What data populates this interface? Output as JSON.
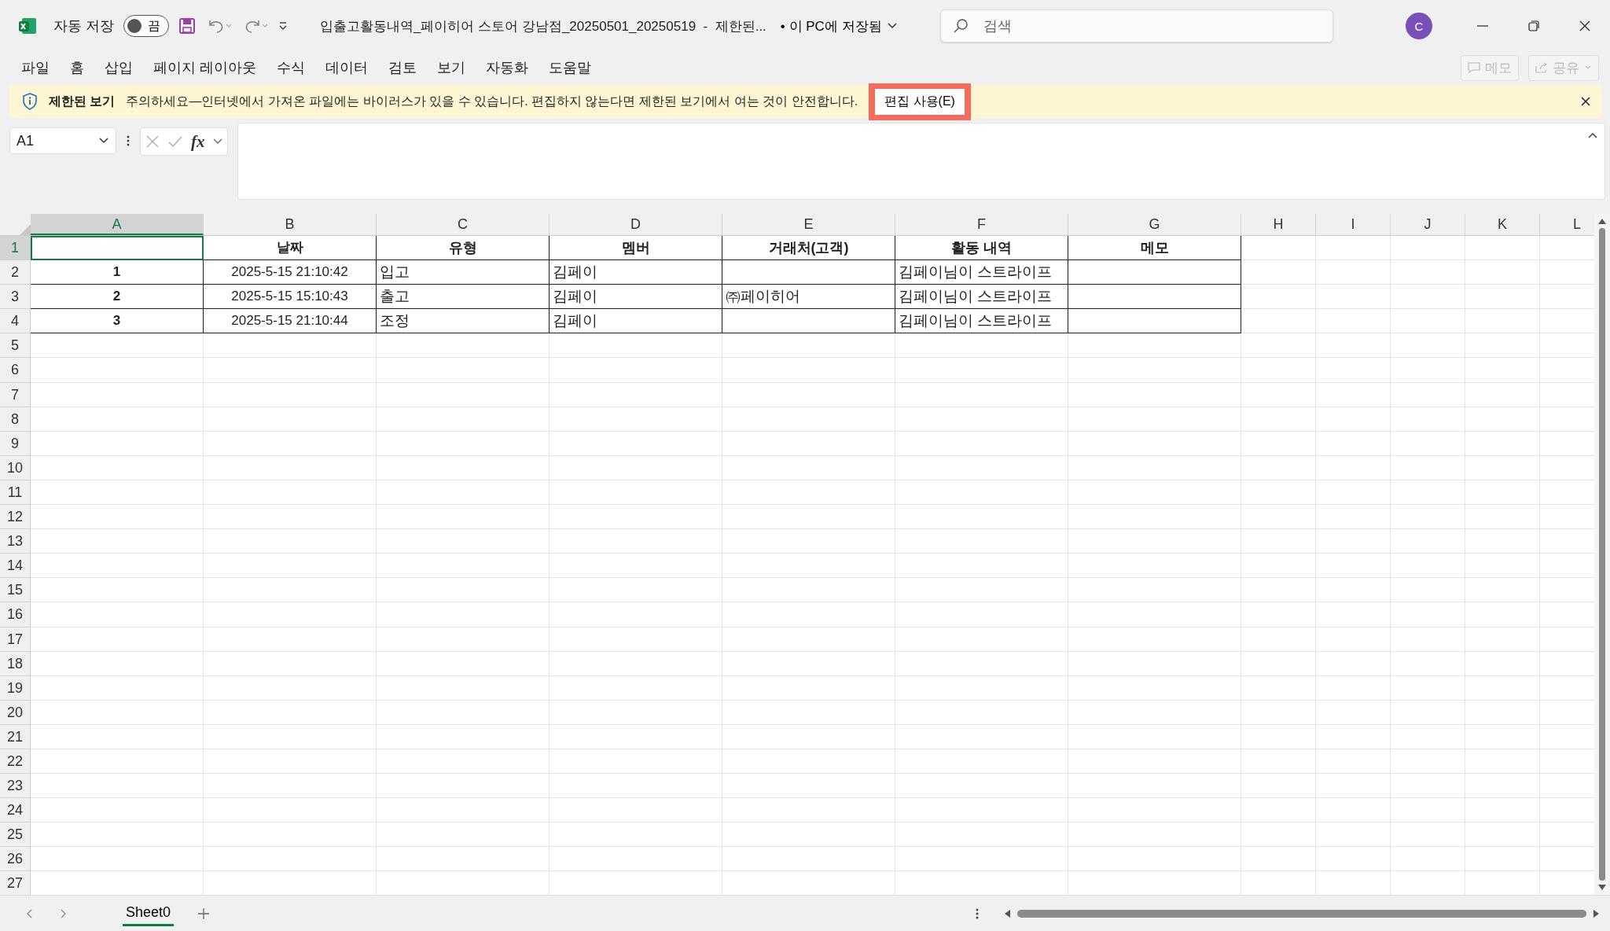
{
  "title_bar": {
    "autosave_label": "자동 저장",
    "autosave": {
      "on": false,
      "label": "끔"
    },
    "document_title": "입출고활동내역_페이히어 스토어 강남점_20250501_20250519  -  제한된...",
    "save_status": "• 이 PC에 저장됨",
    "search": {
      "placeholder": "검색"
    },
    "avatar": "C"
  },
  "menu": [
    {
      "label": "파일"
    },
    {
      "label": "홈"
    },
    {
      "label": "삽입"
    },
    {
      "label": "페이지 레이아웃"
    },
    {
      "label": "수식"
    },
    {
      "label": "데이터"
    },
    {
      "label": "검토"
    },
    {
      "label": "보기"
    },
    {
      "label": "자동화"
    },
    {
      "label": "도움말"
    }
  ],
  "ribbon_buttons": [
    {
      "label": "메모",
      "disabled": true
    },
    {
      "label": "공유",
      "disabled": true
    }
  ],
  "message_bar": {
    "title": "제한된 보기",
    "text": "주의하세요—인터넷에서 가져온 파일에는 바이러스가 있을 수 있습니다. 편집하지 않는다면 제한된 보기에서 여는 것이 안전합니다.",
    "button": "편집 사용(E)"
  },
  "formula_bar": {
    "name_box": "A1",
    "fx": "fx"
  },
  "columns": [
    {
      "label": "A",
      "selected": true
    },
    {
      "label": "B",
      "selected": false
    },
    {
      "label": "C",
      "selected": false
    },
    {
      "label": "D",
      "selected": false
    },
    {
      "label": "E",
      "selected": false
    },
    {
      "label": "F",
      "selected": false
    },
    {
      "label": "G",
      "selected": false
    },
    {
      "label": "H",
      "selected": false
    },
    {
      "label": "I",
      "selected": false
    },
    {
      "label": "J",
      "selected": false
    },
    {
      "label": "K",
      "selected": false
    },
    {
      "label": "L",
      "selected": false
    }
  ],
  "rows": [
    {
      "number": "1",
      "selected": true,
      "cells": [
        "",
        "날짜",
        "유형",
        "멤버",
        "거래처(고객)",
        "활동 내역",
        "메모"
      ]
    },
    {
      "number": "2",
      "selected": false,
      "cells": [
        "1",
        "2025-5-15 21:10:42",
        "입고",
        "김페이",
        "",
        "김페이님이 스트라이프",
        ""
      ]
    },
    {
      "number": "3",
      "selected": false,
      "cells": [
        "2",
        "2025-5-15 15:10:43",
        "출고",
        "김페이",
        "㈜페이히어",
        "김페이님이 스트라이프",
        ""
      ]
    },
    {
      "number": "4",
      "selected": false,
      "cells": [
        "3",
        "2025-5-15 21:10:44",
        "조정",
        "김페이",
        "",
        "김페이님이 스트라이프",
        ""
      ]
    },
    {
      "number": "5",
      "selected": false
    },
    {
      "number": "6",
      "selected": false
    },
    {
      "number": "7",
      "selected": false
    },
    {
      "number": "8",
      "selected": false
    },
    {
      "number": "9",
      "selected": false
    },
    {
      "number": "10",
      "selected": false
    },
    {
      "number": "11",
      "selected": false
    },
    {
      "number": "12",
      "selected": false
    },
    {
      "number": "13",
      "selected": false
    },
    {
      "number": "14",
      "selected": false
    },
    {
      "number": "15",
      "selected": false
    },
    {
      "number": "16",
      "selected": false
    },
    {
      "number": "17",
      "selected": false
    },
    {
      "number": "18",
      "selected": false
    },
    {
      "number": "19",
      "selected": false
    },
    {
      "number": "20",
      "selected": false
    },
    {
      "number": "21",
      "selected": false
    },
    {
      "number": "22",
      "selected": false
    },
    {
      "number": "23",
      "selected": false
    },
    {
      "number": "24",
      "selected": false
    },
    {
      "number": "25",
      "selected": false
    },
    {
      "number": "26",
      "selected": false
    },
    {
      "number": "27",
      "selected": false
    }
  ],
  "sheet_tabs": [
    {
      "label": "Sheet0",
      "selected": true
    }
  ]
}
